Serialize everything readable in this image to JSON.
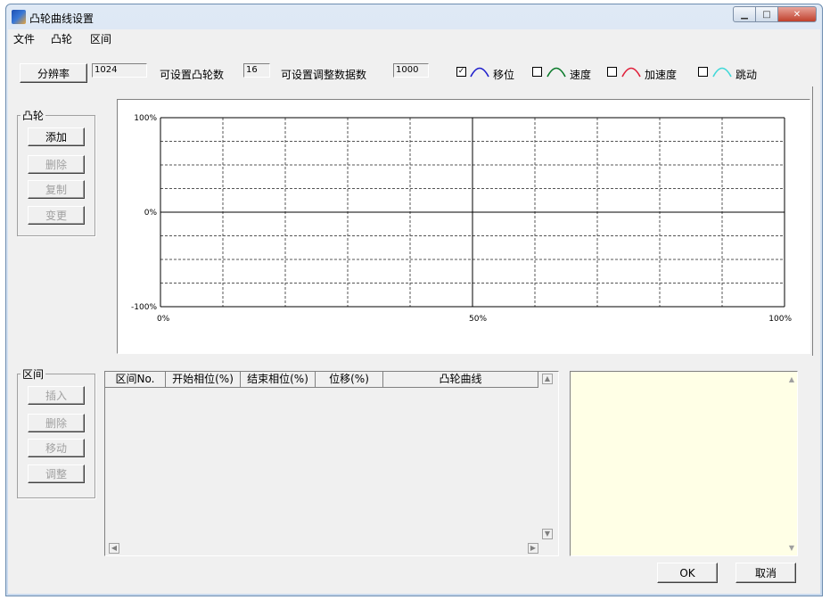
{
  "window": {
    "title": "凸轮曲线设置"
  },
  "menu": {
    "items": [
      "文件",
      "凸轮",
      "区间"
    ]
  },
  "toolbar": {
    "resolution_button": "分辨率",
    "resolution_value": "1024",
    "settable_cams_label": "可设置凸轮数",
    "settable_cams_value": "16",
    "adjust_data_label": "可设置调整数据数",
    "adjust_data_value": "1000",
    "curves": [
      {
        "label": "移位",
        "checked": true,
        "check_mark": "✓",
        "color": "#1f1fcc",
        "icon": "displacement-curve-icon"
      },
      {
        "label": "速度",
        "checked": false,
        "check_mark": "",
        "color": "#0a7a2a",
        "icon": "velocity-curve-icon"
      },
      {
        "label": "加速度",
        "checked": false,
        "check_mark": "",
        "color": "#e0203a",
        "icon": "acceleration-curve-icon"
      },
      {
        "label": "跳动",
        "checked": false,
        "check_mark": "",
        "color": "#40d8d8",
        "icon": "jerk-curve-icon"
      }
    ]
  },
  "cam_group": {
    "title": "凸轮",
    "buttons": [
      {
        "label": "添加",
        "enabled": true
      },
      {
        "label": "删除",
        "enabled": false
      },
      {
        "label": "复制",
        "enabled": false
      },
      {
        "label": "变更",
        "enabled": false
      }
    ]
  },
  "chart_data": {
    "type": "line",
    "series": [],
    "y_tick_labels": [
      "100%",
      "0%",
      "-100%"
    ],
    "x_tick_labels": [
      "0%",
      "50%",
      "100%"
    ],
    "xlim": [
      0,
      100
    ],
    "ylim": [
      -100,
      100
    ],
    "grid": true
  },
  "section_group": {
    "title": "区间",
    "buttons": [
      {
        "label": "插入",
        "enabled": false
      },
      {
        "label": "删除",
        "enabled": false
      },
      {
        "label": "移动",
        "enabled": false
      },
      {
        "label": "调整",
        "enabled": false
      }
    ]
  },
  "section_table": {
    "columns": [
      "区间No.",
      "开始相位(%)",
      "结束相位(%)",
      "位移(%)",
      "凸轮曲线"
    ],
    "rows": []
  },
  "dialog": {
    "ok_label": "OK",
    "cancel_label": "取消"
  }
}
